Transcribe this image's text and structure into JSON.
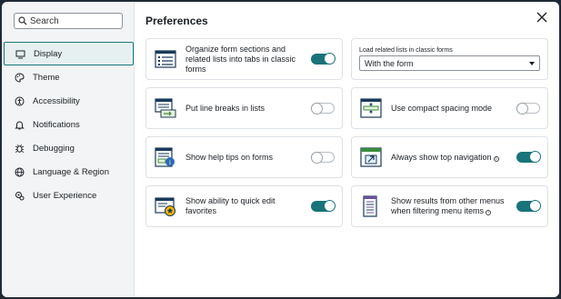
{
  "search": {
    "placeholder": "Search"
  },
  "sidebar": {
    "items": [
      {
        "label": "Display",
        "icon": "monitor-icon",
        "active": true
      },
      {
        "label": "Theme",
        "icon": "palette-icon"
      },
      {
        "label": "Accessibility",
        "icon": "accessibility-icon"
      },
      {
        "label": "Notifications",
        "icon": "bell-icon"
      },
      {
        "label": "Debugging",
        "icon": "bug-icon"
      },
      {
        "label": "Language & Region",
        "icon": "globe-icon"
      },
      {
        "label": "User Experience",
        "icon": "user-experience-icon"
      }
    ]
  },
  "main": {
    "title": "Preferences",
    "cards": {
      "organize": {
        "label": "Organize form sections and related lists into tabs in classic forms",
        "on": true
      },
      "load_related": {
        "label": "Load related lists in classic forms",
        "value": "With the form"
      },
      "line_breaks": {
        "label": "Put line breaks in lists",
        "on": false
      },
      "compact": {
        "label": "Use compact spacing mode",
        "on": false
      },
      "help_tips": {
        "label": "Show help tips on forms",
        "on": false
      },
      "top_nav": {
        "label": "Always show top navigation",
        "on": true
      },
      "quick_edit": {
        "label": "Show ability to quick edit favorites",
        "on": true
      },
      "filter_menus": {
        "label": "Show results from other menus when filtering menu items",
        "on": true
      }
    }
  },
  "colors": {
    "accent": "#18747a",
    "active_bg": "#e7f0f0"
  }
}
